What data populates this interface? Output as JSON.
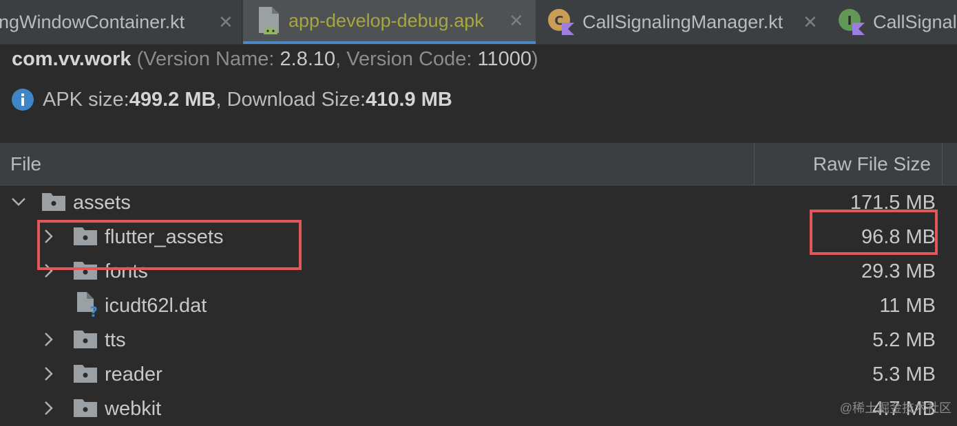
{
  "tabs": [
    {
      "label": "ingWindowContainer.kt",
      "close": "✕"
    },
    {
      "label": "app-develop-debug.apk",
      "close": "✕"
    },
    {
      "label": "CallSignalingManager.kt",
      "close": "✕"
    },
    {
      "label": "CallSignal"
    }
  ],
  "header": {
    "package": "com.vv.work",
    "version_name_label": "(Version Name: ",
    "version_name": "2.8.10",
    "version_code_label": ", Version Code: ",
    "version_code": "11000",
    "close_paren": ")",
    "apk_size_label": "APK size: ",
    "apk_size": "499.2 MB",
    "download_size_label": ", Download Size: ",
    "download_size": "410.9 MB"
  },
  "table": {
    "columns": [
      "File",
      "Raw File Size"
    ],
    "rows": [
      {
        "name": "assets",
        "size": "171.5 MB",
        "expanded": true,
        "type": "folder"
      },
      {
        "name": "flutter_assets",
        "size": "96.8 MB",
        "type": "folder"
      },
      {
        "name": "fonts",
        "size": "29.3 MB",
        "type": "folder"
      },
      {
        "name": "icudt62l.dat",
        "size": "11 MB",
        "type": "file"
      },
      {
        "name": "tts",
        "size": "5.2 MB",
        "type": "folder"
      },
      {
        "name": "reader",
        "size": "5.3 MB",
        "type": "folder"
      },
      {
        "name": "webkit",
        "size": "4.7 MB",
        "type": "folder"
      }
    ]
  },
  "watermark": "@稀土掘金技术社区",
  "colors": {
    "highlight": "#e2585a",
    "accent": "#4a88c7",
    "apk_tab_text": "#a7a73e"
  }
}
